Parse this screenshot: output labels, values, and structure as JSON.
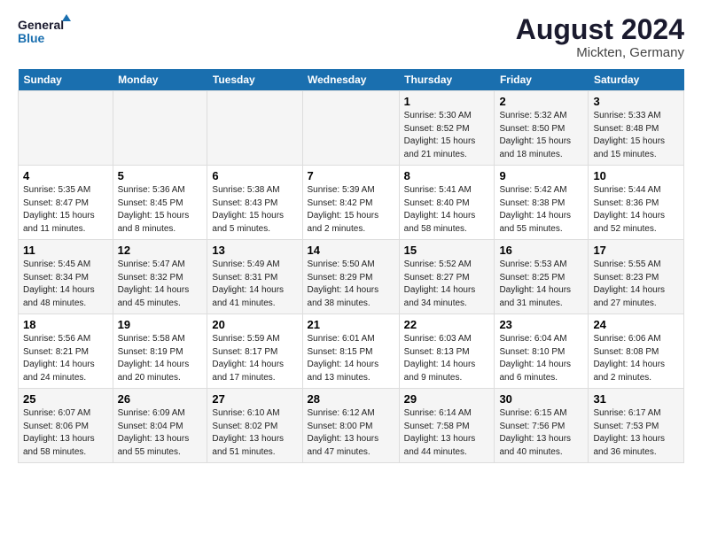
{
  "logo": {
    "line1": "General",
    "line2": "Blue"
  },
  "title": "August 2024",
  "subtitle": "Mickten, Germany",
  "days_of_week": [
    "Sunday",
    "Monday",
    "Tuesday",
    "Wednesday",
    "Thursday",
    "Friday",
    "Saturday"
  ],
  "weeks": [
    [
      {
        "day": "",
        "info": ""
      },
      {
        "day": "",
        "info": ""
      },
      {
        "day": "",
        "info": ""
      },
      {
        "day": "",
        "info": ""
      },
      {
        "day": "1",
        "info": "Sunrise: 5:30 AM\nSunset: 8:52 PM\nDaylight: 15 hours\nand 21 minutes."
      },
      {
        "day": "2",
        "info": "Sunrise: 5:32 AM\nSunset: 8:50 PM\nDaylight: 15 hours\nand 18 minutes."
      },
      {
        "day": "3",
        "info": "Sunrise: 5:33 AM\nSunset: 8:48 PM\nDaylight: 15 hours\nand 15 minutes."
      }
    ],
    [
      {
        "day": "4",
        "info": "Sunrise: 5:35 AM\nSunset: 8:47 PM\nDaylight: 15 hours\nand 11 minutes."
      },
      {
        "day": "5",
        "info": "Sunrise: 5:36 AM\nSunset: 8:45 PM\nDaylight: 15 hours\nand 8 minutes."
      },
      {
        "day": "6",
        "info": "Sunrise: 5:38 AM\nSunset: 8:43 PM\nDaylight: 15 hours\nand 5 minutes."
      },
      {
        "day": "7",
        "info": "Sunrise: 5:39 AM\nSunset: 8:42 PM\nDaylight: 15 hours\nand 2 minutes."
      },
      {
        "day": "8",
        "info": "Sunrise: 5:41 AM\nSunset: 8:40 PM\nDaylight: 14 hours\nand 58 minutes."
      },
      {
        "day": "9",
        "info": "Sunrise: 5:42 AM\nSunset: 8:38 PM\nDaylight: 14 hours\nand 55 minutes."
      },
      {
        "day": "10",
        "info": "Sunrise: 5:44 AM\nSunset: 8:36 PM\nDaylight: 14 hours\nand 52 minutes."
      }
    ],
    [
      {
        "day": "11",
        "info": "Sunrise: 5:45 AM\nSunset: 8:34 PM\nDaylight: 14 hours\nand 48 minutes."
      },
      {
        "day": "12",
        "info": "Sunrise: 5:47 AM\nSunset: 8:32 PM\nDaylight: 14 hours\nand 45 minutes."
      },
      {
        "day": "13",
        "info": "Sunrise: 5:49 AM\nSunset: 8:31 PM\nDaylight: 14 hours\nand 41 minutes."
      },
      {
        "day": "14",
        "info": "Sunrise: 5:50 AM\nSunset: 8:29 PM\nDaylight: 14 hours\nand 38 minutes."
      },
      {
        "day": "15",
        "info": "Sunrise: 5:52 AM\nSunset: 8:27 PM\nDaylight: 14 hours\nand 34 minutes."
      },
      {
        "day": "16",
        "info": "Sunrise: 5:53 AM\nSunset: 8:25 PM\nDaylight: 14 hours\nand 31 minutes."
      },
      {
        "day": "17",
        "info": "Sunrise: 5:55 AM\nSunset: 8:23 PM\nDaylight: 14 hours\nand 27 minutes."
      }
    ],
    [
      {
        "day": "18",
        "info": "Sunrise: 5:56 AM\nSunset: 8:21 PM\nDaylight: 14 hours\nand 24 minutes."
      },
      {
        "day": "19",
        "info": "Sunrise: 5:58 AM\nSunset: 8:19 PM\nDaylight: 14 hours\nand 20 minutes."
      },
      {
        "day": "20",
        "info": "Sunrise: 5:59 AM\nSunset: 8:17 PM\nDaylight: 14 hours\nand 17 minutes."
      },
      {
        "day": "21",
        "info": "Sunrise: 6:01 AM\nSunset: 8:15 PM\nDaylight: 14 hours\nand 13 minutes."
      },
      {
        "day": "22",
        "info": "Sunrise: 6:03 AM\nSunset: 8:13 PM\nDaylight: 14 hours\nand 9 minutes."
      },
      {
        "day": "23",
        "info": "Sunrise: 6:04 AM\nSunset: 8:10 PM\nDaylight: 14 hours\nand 6 minutes."
      },
      {
        "day": "24",
        "info": "Sunrise: 6:06 AM\nSunset: 8:08 PM\nDaylight: 14 hours\nand 2 minutes."
      }
    ],
    [
      {
        "day": "25",
        "info": "Sunrise: 6:07 AM\nSunset: 8:06 PM\nDaylight: 13 hours\nand 58 minutes."
      },
      {
        "day": "26",
        "info": "Sunrise: 6:09 AM\nSunset: 8:04 PM\nDaylight: 13 hours\nand 55 minutes."
      },
      {
        "day": "27",
        "info": "Sunrise: 6:10 AM\nSunset: 8:02 PM\nDaylight: 13 hours\nand 51 minutes."
      },
      {
        "day": "28",
        "info": "Sunrise: 6:12 AM\nSunset: 8:00 PM\nDaylight: 13 hours\nand 47 minutes."
      },
      {
        "day": "29",
        "info": "Sunrise: 6:14 AM\nSunset: 7:58 PM\nDaylight: 13 hours\nand 44 minutes."
      },
      {
        "day": "30",
        "info": "Sunrise: 6:15 AM\nSunset: 7:56 PM\nDaylight: 13 hours\nand 40 minutes."
      },
      {
        "day": "31",
        "info": "Sunrise: 6:17 AM\nSunset: 7:53 PM\nDaylight: 13 hours\nand 36 minutes."
      }
    ]
  ]
}
